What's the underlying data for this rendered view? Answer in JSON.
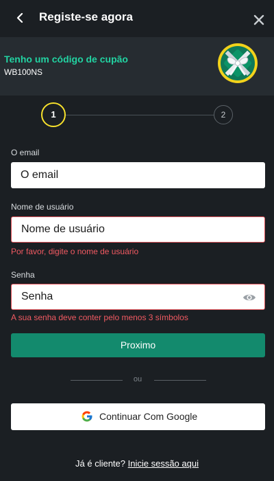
{
  "header": {
    "title": "Registe-se agora"
  },
  "promo": {
    "title": "Tenho um código de cupão",
    "code": "WB100NS"
  },
  "stepper": {
    "step1": "1",
    "step2": "2"
  },
  "form": {
    "email": {
      "label": "O email",
      "placeholder": "O email",
      "value": ""
    },
    "username": {
      "label": "Nome de usuário",
      "placeholder": "Nome de usuário",
      "value": "",
      "error": "Por favor, digite o nome de usuário"
    },
    "password": {
      "label": "Senha",
      "placeholder": "Senha",
      "value": "",
      "error": "A sua senha deve conter pelo menos 3 símbolos"
    },
    "next_label": "Proximo"
  },
  "divider": {
    "or_label": "ou"
  },
  "google": {
    "label": "Continuar Com Google"
  },
  "footer": {
    "question": "Já é cliente?",
    "login_link": "Inicie sessão aqui"
  },
  "colors": {
    "background": "#1b1f23",
    "promo_bg": "#262c31",
    "accent_green": "#138a6d",
    "promo_title": "#22d3a2",
    "step_active": "#f7e12c",
    "error": "#f25a62"
  },
  "icons": [
    "chevron-left-icon",
    "close-icon",
    "gift-icon",
    "eye-icon",
    "google-icon"
  ]
}
